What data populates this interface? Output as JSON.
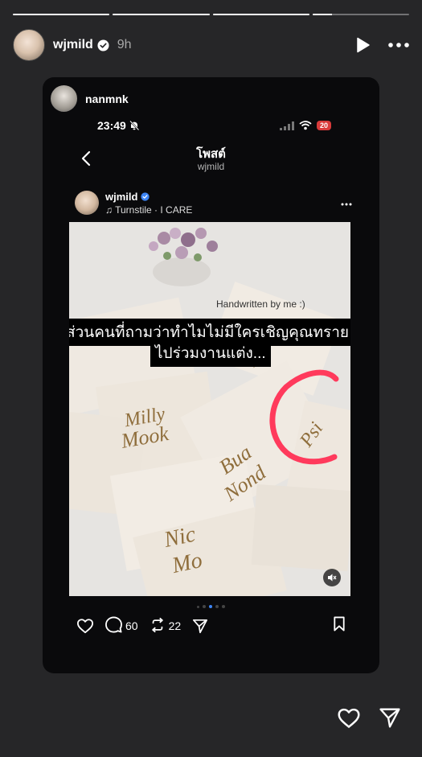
{
  "progress": [
    1.0,
    1.0,
    1.0,
    0.2
  ],
  "story": {
    "username": "wjmild",
    "time": "9h"
  },
  "reshare": {
    "username": "nanmnk"
  },
  "phone": {
    "clock": "23:49",
    "battery": "20"
  },
  "nav": {
    "title": "โพสต์",
    "subtitle": "wjmild"
  },
  "post": {
    "username": "wjmild",
    "music": "Turnstile · I CARE",
    "handwritten": "Handwritten by me :)",
    "caption_line1": "ส่วนคนที่ถามว่าทำไมไม่มีใครเชิญคุณทราย",
    "caption_line2": "ไปร่วมงานแต่ง...",
    "carousel_active": 3,
    "comments": "60",
    "reposts": "22"
  },
  "colors": {
    "background": "#262628",
    "accent_blue": "#3d85f6",
    "circle_red": "#ff3a5c"
  }
}
